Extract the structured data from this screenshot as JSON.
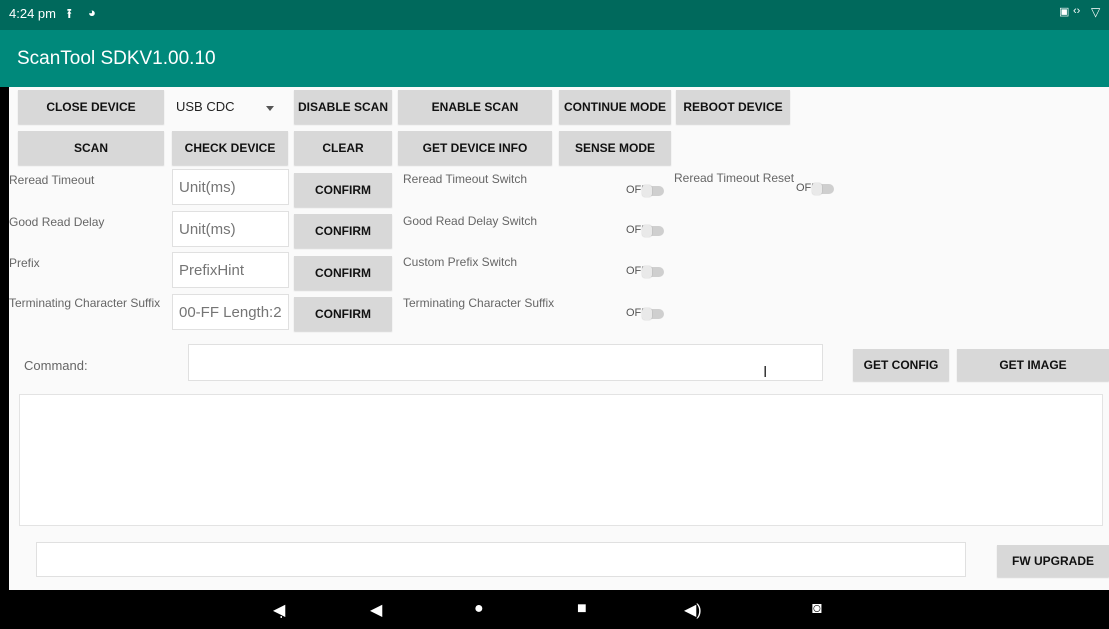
{
  "status": {
    "time": "4:24 pm",
    "icons": [
      "upload-icon",
      "sync-icon",
      "cast-icon",
      "code-icon",
      "wifi-icon"
    ]
  },
  "app": {
    "title": "ScanTool SDKV1.00.10"
  },
  "row1": {
    "close_device": "CLOSE DEVICE",
    "connection": "USB CDC",
    "disable_scan": "DISABLE SCAN",
    "enable_scan": "ENABLE SCAN",
    "continue_mode": "CONTINUE MODE",
    "reboot_device": "REBOOT DEVICE"
  },
  "row2": {
    "scan": "SCAN",
    "check_device": "CHECK DEVICE",
    "clear": "CLEAR",
    "get_device_info": "GET DEVICE INFO",
    "sense_mode": "SENSE MODE"
  },
  "settings": [
    {
      "label": "Reread Timeout",
      "placeholder": "Unit(ms)",
      "confirm": "CONFIRM",
      "switch_label": "Reread Timeout Switch",
      "switch_state": "OFF"
    },
    {
      "label": "Good Read Delay",
      "placeholder": "Unit(ms)",
      "confirm": "CONFIRM",
      "switch_label": "Good Read Delay Switch",
      "switch_state": "OFF"
    },
    {
      "label": "Prefix",
      "placeholder": "PrefixHint",
      "confirm": "CONFIRM",
      "switch_label": "Custom Prefix Switch",
      "switch_state": "OFF"
    },
    {
      "label": "Terminating Character Suffix",
      "placeholder": "00-FF Length:2",
      "confirm": "CONFIRM",
      "switch_label": "Terminating Character Suffix",
      "switch_state": "OFF"
    }
  ],
  "reread_reset": {
    "label": "Reread Timeout Reset",
    "state": "OFF"
  },
  "command": {
    "label": "Command:",
    "value": "",
    "get_config": "GET CONFIG",
    "get_image": "GET IMAGE"
  },
  "output": {
    "text": ""
  },
  "firmware": {
    "value": "",
    "upgrade": "FW UPGRADE"
  },
  "nav": [
    "volume-down-icon",
    "back-icon",
    "home-icon",
    "recents-icon",
    "volume-up-icon",
    "camera-icon"
  ]
}
